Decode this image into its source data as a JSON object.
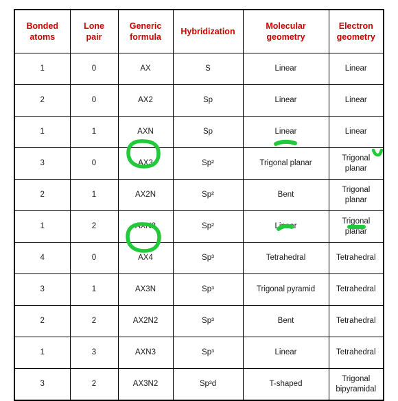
{
  "table": {
    "name": "VSEPR geometry reference table",
    "header_color": "#CC0000",
    "body_text_color": "#1a1a1a",
    "border_color": "#000000",
    "background_color": "#ffffff",
    "columns": [
      {
        "key": "bonded_atoms",
        "label": "Bonded atoms",
        "line1": "Bonded",
        "line2": "atoms"
      },
      {
        "key": "lone_pair",
        "label": "Lone pair",
        "line1": "Lone",
        "line2": "pair"
      },
      {
        "key": "generic_formula",
        "label": "Generic formula",
        "line1": "Generic",
        "line2": "formula"
      },
      {
        "key": "hybridization",
        "label": "Hybridization",
        "line1": "Hybridization",
        "line2": ""
      },
      {
        "key": "molecular_geometry",
        "label": "Molecular geometry",
        "line1": "Molecular",
        "line2": "geometry"
      },
      {
        "key": "electron_geometry",
        "label": "Electron geometry",
        "line1": "Electron",
        "line2": "geometry"
      }
    ],
    "rows": [
      {
        "bonded_atoms": "1",
        "lone_pair": "0",
        "generic_formula": "AX",
        "hybridization": "S",
        "molecular_geometry": "Linear",
        "electron_geometry": "Linear"
      },
      {
        "bonded_atoms": "2",
        "lone_pair": "0",
        "generic_formula": "AX2",
        "hybridization": "Sp",
        "molecular_geometry": "Linear",
        "electron_geometry": "Linear"
      },
      {
        "bonded_atoms": "1",
        "lone_pair": "1",
        "generic_formula": "AXN",
        "hybridization": "Sp",
        "molecular_geometry": "Linear",
        "electron_geometry": "Linear"
      },
      {
        "bonded_atoms": "3",
        "lone_pair": "0",
        "generic_formula": "AX3",
        "hybridization": "Sp²",
        "molecular_geometry": "Trigonal planar",
        "electron_geometry": "Trigonal planar"
      },
      {
        "bonded_atoms": "2",
        "lone_pair": "1",
        "generic_formula": "AX2N",
        "hybridization": "Sp²",
        "molecular_geometry": "Bent",
        "electron_geometry": "Trigonal planar"
      },
      {
        "bonded_atoms": "1",
        "lone_pair": "2",
        "generic_formula": "AXN2",
        "hybridization": "Sp²",
        "molecular_geometry": "Linear",
        "electron_geometry": "Trigonal planar"
      },
      {
        "bonded_atoms": "4",
        "lone_pair": "0",
        "generic_formula": "AX4",
        "hybridization": "Sp³",
        "molecular_geometry": "Tetrahedral",
        "electron_geometry": "Tetrahedral"
      },
      {
        "bonded_atoms": "3",
        "lone_pair": "1",
        "generic_formula": "AX3N",
        "hybridization": "Sp³",
        "molecular_geometry": "Trigonal pyramid",
        "electron_geometry": "Tetrahedral"
      },
      {
        "bonded_atoms": "2",
        "lone_pair": "2",
        "generic_formula": "AX2N2",
        "hybridization": "Sp³",
        "molecular_geometry": "Bent",
        "electron_geometry": "Tetrahedral"
      },
      {
        "bonded_atoms": "1",
        "lone_pair": "3",
        "generic_formula": "AXN3",
        "hybridization": "Sp³",
        "molecular_geometry": "Linear",
        "electron_geometry": "Tetrahedral"
      },
      {
        "bonded_atoms": "3",
        "lone_pair": "2",
        "generic_formula": "AX3N2",
        "hybridization": "Sp³d",
        "molecular_geometry": "T-shaped",
        "electron_geometry": "Trigonal bipyramidal"
      }
    ]
  },
  "annotations": {
    "color": "#22C93A",
    "marks": [
      {
        "name": "circle-ax3",
        "kind": "circle",
        "target": "AX3"
      },
      {
        "name": "circle-ax4",
        "kind": "circle",
        "target": "AX4"
      },
      {
        "name": "dash-trigonal-planar-molecular",
        "kind": "dash",
        "target": "Trigonal planar"
      },
      {
        "name": "check-trigonal-planar-electron",
        "kind": "check",
        "target": "Trigonal planar"
      },
      {
        "name": "dash-tetrahedral-molecular",
        "kind": "dash",
        "target": "Tetrahedral"
      },
      {
        "name": "dash-tetrahedral-electron",
        "kind": "dash",
        "target": "Tetrahedral"
      }
    ]
  }
}
